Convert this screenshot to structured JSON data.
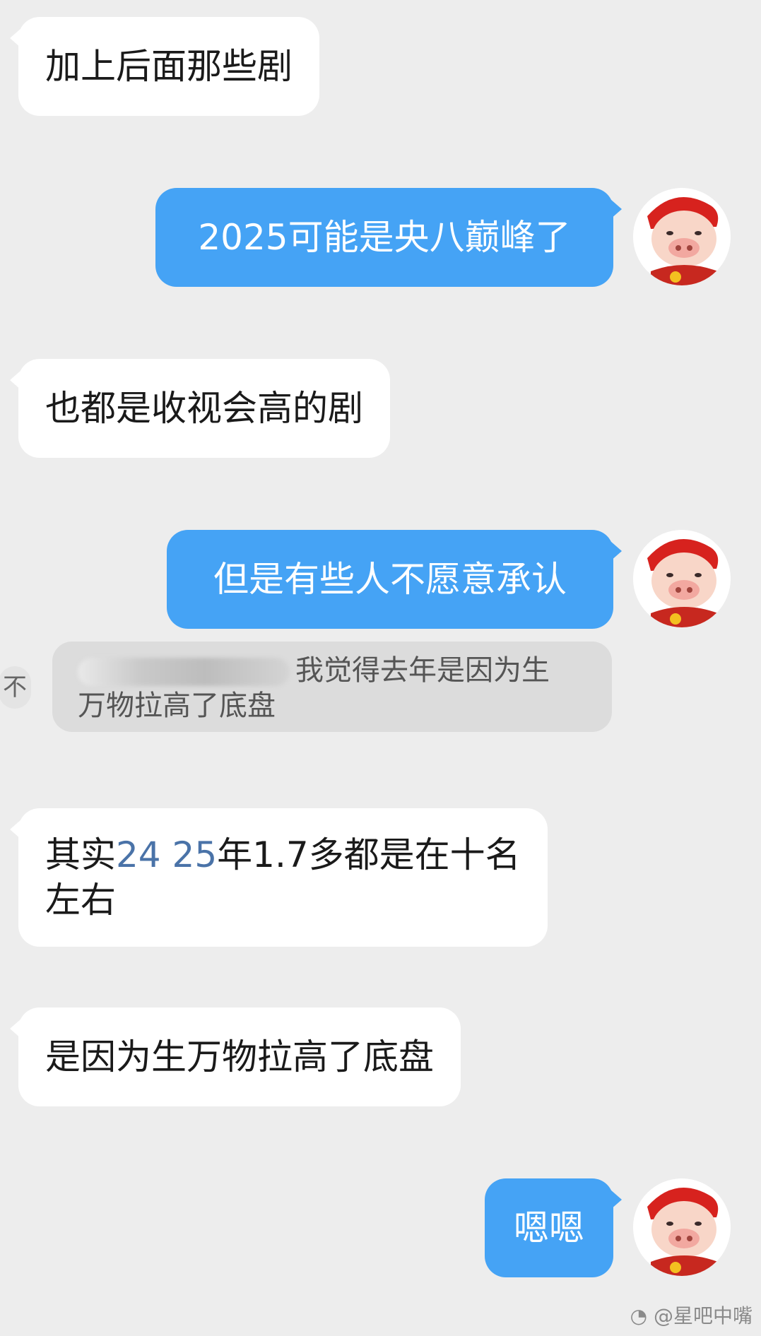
{
  "messages": {
    "m1": "加上后面那些剧",
    "m2": "2025可能是央八巅峰了",
    "m3": "也都是收视会高的剧",
    "m4": "但是有些人不愿意承认",
    "m5_prefix": "其实",
    "m5_num": "24 25",
    "m5_rest": "年1.7多都是在十名",
    "m5_line2": "左右",
    "m6": "是因为生万物拉高了底盘",
    "m7": "嗯嗯"
  },
  "quote": {
    "line1_visible": "我觉得去年是因为生",
    "line2": "万物拉高了底盘",
    "icon": "不"
  },
  "watermark": "@星吧中嘴",
  "colors": {
    "background": "#ededed",
    "incoming_bubble": "#ffffff",
    "outgoing_bubble": "#45a3f5",
    "number_highlight": "#4a73a8"
  },
  "avatar_icon": "pig-avatar-icon"
}
